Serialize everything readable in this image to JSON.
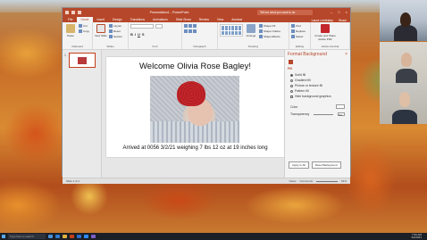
{
  "window": {
    "title": "Presentation1 - PowerPoint",
    "search_placeholder": "Tell me what you want to do",
    "user": "Laura Lenfestey",
    "share": "Share"
  },
  "ribbon_tabs": [
    "File",
    "Home",
    "Insert",
    "Design",
    "Transitions",
    "Animations",
    "Slide Show",
    "Review",
    "View",
    "Acrobat"
  ],
  "ribbon": {
    "paste": "Paste",
    "cut": "Cut",
    "copy": "Copy",
    "format_painter": "Format Painter",
    "new_slide": "New Slide",
    "layout": "Layout",
    "reset": "Reset",
    "section": "Section",
    "clipboard": "Clipboard",
    "slides": "Slides",
    "font": "Font",
    "paragraph": "Paragraph",
    "drawing": "Drawing",
    "editing": "Editing",
    "adobe": "Adobe Acrobat",
    "font_name": "",
    "bold": "B",
    "italic": "I",
    "underline": "U",
    "shadow": "S",
    "arrange": "Arrange",
    "quick_styles": "Quick Styles",
    "shape_fill": "Shape Fill",
    "shape_outline": "Shape Outline",
    "shape_effects": "Shape Effects",
    "find": "Find",
    "replace": "Replace",
    "select": "Select",
    "create_share": "Create and Share Adobe PDF"
  },
  "slide_panel": {
    "slide_number": "1"
  },
  "slide": {
    "title": "Welcome Olivia Rose Bagley!",
    "caption": "Arrived at 0056 3/2/21 weighing 7 lbs 12 oz at 19 inches long"
  },
  "format_pane": {
    "title": "Format Background",
    "close": "×",
    "section": "Fill",
    "options": [
      "Solid fill",
      "Gradient fill",
      "Picture or texture fill",
      "Pattern fill",
      "Hide background graphics"
    ],
    "selected_index": 0,
    "color_label": "Color",
    "transparency_label": "Transparency",
    "transparency_value": "0%",
    "apply_all": "Apply to All",
    "reset_background": "Reset Background"
  },
  "statusbar": {
    "slide_info": "Slide 1 of 1",
    "notes": "Notes",
    "comments": "Comments",
    "zoom": "54%"
  },
  "taskbar": {
    "search_placeholder": "Type here to search",
    "time": "7:53 AM",
    "date": "3/2/2021"
  }
}
